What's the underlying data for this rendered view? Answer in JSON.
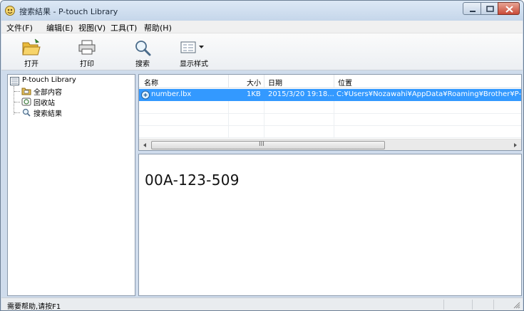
{
  "window": {
    "title": "搜索結果 - P-touch Library"
  },
  "menu": [
    {
      "label": "文件(F)"
    },
    {
      "label": "编辑(E)"
    },
    {
      "label": "视图(V)"
    },
    {
      "label": "工具(T)"
    },
    {
      "label": "帮助(H)"
    }
  ],
  "toolbar": {
    "open": "打开",
    "print": "打印",
    "search": "搜索",
    "display_style": "显示样式"
  },
  "tree": {
    "root": "P-touch Library",
    "all": "全部内容",
    "recycle": "回收站",
    "search_results": "搜索結果"
  },
  "list": {
    "columns": [
      "名称",
      "大小",
      "日期",
      "位置"
    ],
    "rows": [
      {
        "name": "number.lbx",
        "size": "1KB",
        "date": "2015/3/20 19:18...",
        "location": "C:¥Users¥Nozawahi¥AppData¥Roaming¥Brother¥P-to"
      }
    ],
    "scroll_marker": "III"
  },
  "preview": {
    "text": "00A-123-509"
  },
  "status": {
    "text": "需要帮助,请按F1"
  },
  "colors": {
    "selection": "#3399ff",
    "close_button": "#c94a37"
  }
}
